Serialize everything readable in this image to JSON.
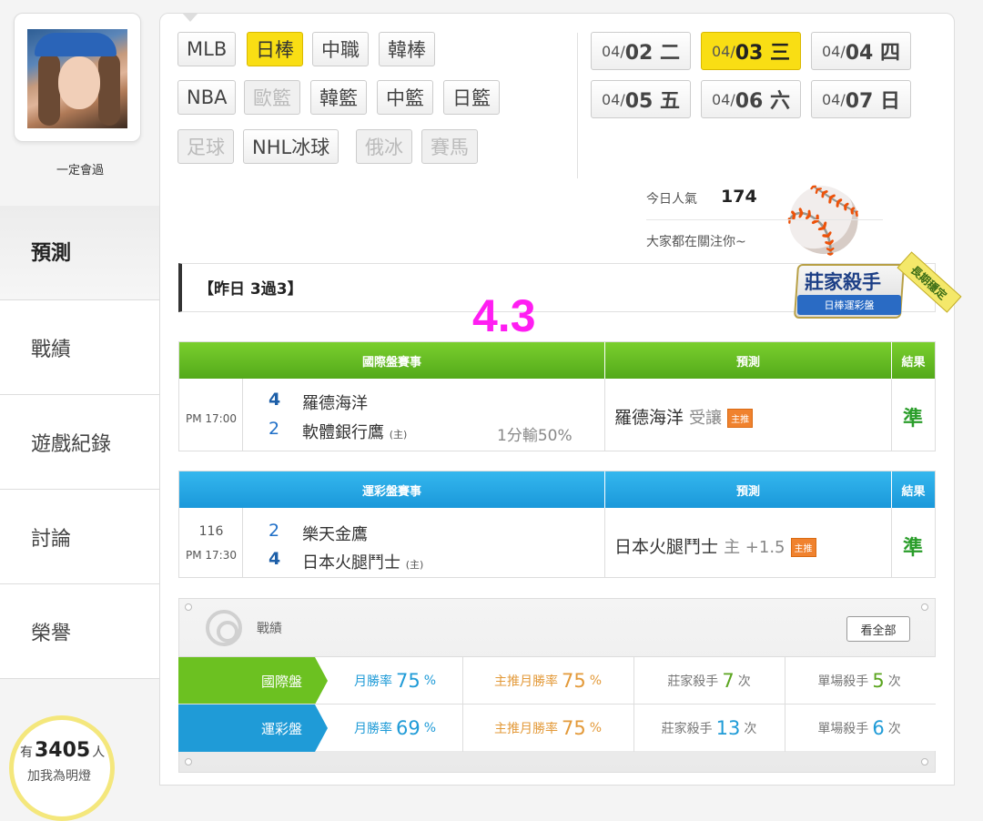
{
  "user": {
    "name": "一定會過"
  },
  "sidebar": {
    "items": [
      {
        "label": "預測",
        "active": true
      },
      {
        "label": "戰績"
      },
      {
        "label": "遊戲紀錄"
      },
      {
        "label": "討論"
      },
      {
        "label": "榮譽"
      }
    ],
    "lights": {
      "prefix": "有",
      "count": "3405",
      "suffix": "人",
      "sub": "加我為明燈"
    }
  },
  "leagues": [
    {
      "label": "MLB",
      "state": "normal"
    },
    {
      "label": "日棒",
      "state": "active"
    },
    {
      "label": "中職",
      "state": "normal"
    },
    {
      "label": "韓棒",
      "state": "normal"
    },
    {
      "label": "NBA",
      "state": "normal"
    },
    {
      "label": "歐籃",
      "state": "disabled"
    },
    {
      "label": "韓籃",
      "state": "normal"
    },
    {
      "label": "中籃",
      "state": "normal"
    },
    {
      "label": "日籃",
      "state": "normal"
    },
    {
      "label": "足球",
      "state": "disabled"
    },
    {
      "label": "NHL冰球",
      "state": "normal"
    },
    {
      "label": "俄冰",
      "state": "disabled"
    },
    {
      "label": "賽馬",
      "state": "disabled"
    }
  ],
  "dates": [
    {
      "prefix": "04/",
      "main": "02 二",
      "active": false
    },
    {
      "prefix": "04/",
      "main": "03 三",
      "active": true
    },
    {
      "prefix": "04/",
      "main": "04 四",
      "active": false
    },
    {
      "prefix": "04/",
      "main": "05 五",
      "active": false
    },
    {
      "prefix": "04/",
      "main": "06 六",
      "active": false
    },
    {
      "prefix": "04/",
      "main": "07 日",
      "active": false
    }
  ],
  "popularity": {
    "label": "今日人氣",
    "value": "174",
    "sub": "大家都在關注你~"
  },
  "yesterday": {
    "text": "【昨日 3過3】"
  },
  "overlay_number": "4.3",
  "badge": {
    "title": "莊家殺手",
    "ribbon": "日棒運彩盤",
    "corner": "長期穩定"
  },
  "intl_table": {
    "headers": [
      "國際盤賽事",
      "預測",
      "結果"
    ],
    "row": {
      "time": "PM 17:00",
      "team1_score": "4",
      "team1": "羅德海洋",
      "team2_score": "2",
      "team2": "軟體銀行鷹",
      "home_mark": "(主)",
      "odds": "1分輸50%",
      "pick": "羅德海洋",
      "pick_type": "受讓",
      "tag": "主推",
      "result": "準"
    }
  },
  "sport_table": {
    "headers": [
      "運彩盤賽事",
      "預測",
      "結果"
    ],
    "row": {
      "game_no": "116",
      "time": "PM 17:30",
      "team1_score": "2",
      "team1": "樂天金鷹",
      "team2_score": "4",
      "team2": "日本火腿鬥士",
      "home_mark": "(主)",
      "pick": "日本火腿鬥士",
      "pick_type": "主 +1.5",
      "tag": "主推",
      "result": "準"
    }
  },
  "stats": {
    "title": "戰績",
    "view_all": "看全部",
    "rows": [
      {
        "label": "國際盤",
        "color": "#6cc121",
        "monthly_label": "月勝率",
        "monthly": "75",
        "pct": "%",
        "main_label": "主推月勝率",
        "main": "75",
        "main_pct": "%",
        "killer_label": "莊家殺手",
        "killer": "7",
        "unit": "次",
        "single_label": "單場殺手",
        "single": "5",
        "single_unit": "次"
      },
      {
        "label": "運彩盤",
        "color": "#1f9bd7",
        "monthly_label": "月勝率",
        "monthly": "69",
        "pct": "%",
        "main_label": "主推月勝率",
        "main": "75",
        "main_pct": "%",
        "killer_label": "莊家殺手",
        "killer": "13",
        "unit": "次",
        "single_label": "單場殺手",
        "single": "6",
        "single_unit": "次"
      }
    ]
  }
}
